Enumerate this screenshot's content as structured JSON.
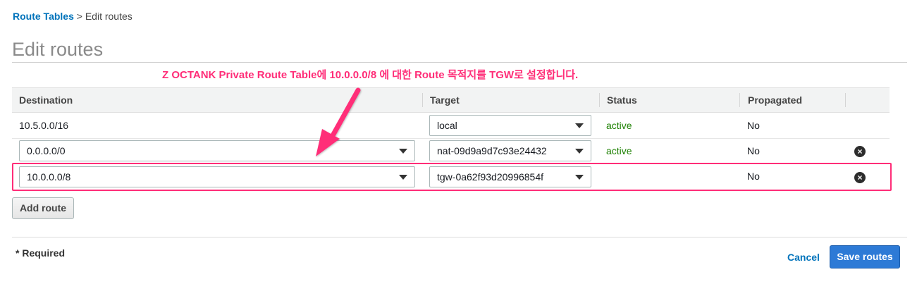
{
  "breadcrumb": {
    "root": "Route Tables",
    "separator": ">",
    "current": "Edit routes"
  },
  "page": {
    "title": "Edit routes"
  },
  "annotation": {
    "text": "Z OCTANK Private Route Table에 10.0.0.0/8 에 대한 Route 목적지를 TGW로 설정합니다.",
    "color": "#ff2d78"
  },
  "table": {
    "headers": [
      "Destination",
      "Target",
      "Status",
      "Propagated"
    ],
    "rows": [
      {
        "destination": "10.5.0.0/16",
        "target": "local",
        "status": "active",
        "propagated": "No"
      },
      {
        "destination": "0.0.0.0/0",
        "target": "nat-09d9a9d7c93e24432",
        "status": "active",
        "propagated": "No"
      },
      {
        "destination": "10.0.0.0/8",
        "target": "tgw-0a62f93d20996854f",
        "status": "",
        "propagated": "No"
      }
    ]
  },
  "actions": {
    "add_route": "Add route",
    "cancel": "Cancel",
    "save": "Save routes"
  },
  "footer": {
    "required": "* Required"
  },
  "colors": {
    "link": "#0073bb",
    "active": "#1d8102",
    "primary_button": "#2d7ad6",
    "annotation": "#ff2d78"
  },
  "icons": {
    "select_caret": "chevron-down-icon",
    "remove": "close-circle-icon",
    "annotation_arrow": "arrow-icon"
  }
}
